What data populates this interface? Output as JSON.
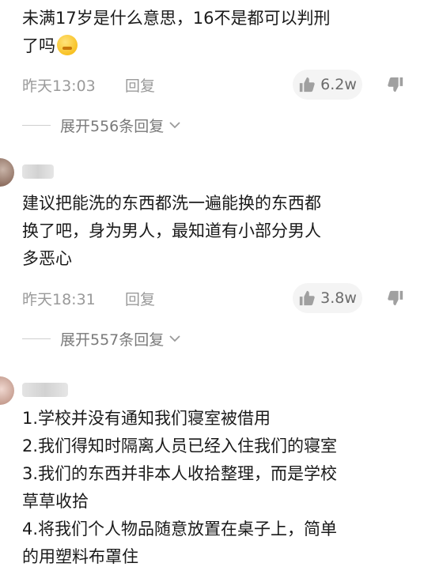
{
  "comments": [
    {
      "text_line1": "未满17岁是什么意思，16不是都可以判刑",
      "text_line2": "了吗",
      "time": "昨天13:03",
      "reply_label": "回复",
      "likes": "6.2w",
      "expand_label": "展开556条回复"
    },
    {
      "text_line1": "建议把能洗的东西都洗一遍能换的东西都",
      "text_line2": "换了吧，身为男人，最知道有小部分男人",
      "text_line3": "多恶心",
      "time": "昨天18:31",
      "reply_label": "回复",
      "likes": "3.8w",
      "expand_label": "展开557条回复"
    },
    {
      "lines": [
        "1.学校并没有通知我们寝室被借用",
        "2.我们得知时隔离人员已经入住我们的寝室",
        "3.我们的东西并非本人收拾整理，而是学校",
        "草草收拾",
        "4.将我们个人物品随意放置在桌子上，简单",
        "的用塑料布罩住"
      ]
    }
  ],
  "icons": {
    "like": "thumbs-up-icon",
    "dislike": "thumbs-down-icon",
    "expand": "chevron-down-icon",
    "emoji": "shush-face-emoji"
  },
  "colors": {
    "text": "#1a1a1a",
    "meta": "#9a9a9a",
    "pill_bg": "#f4f4f4"
  }
}
